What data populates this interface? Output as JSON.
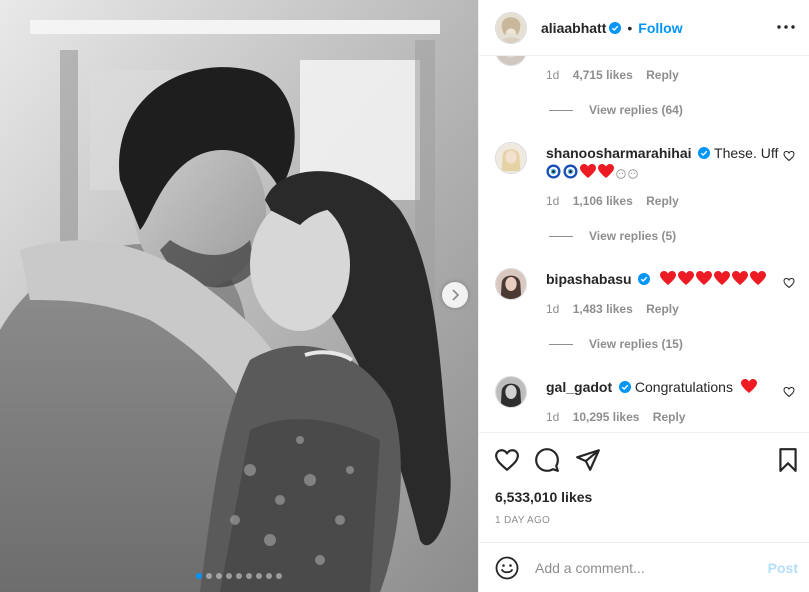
{
  "author": {
    "username": "aliaabhatt",
    "separator": "•",
    "follow_label": "Follow"
  },
  "comments": {
    "first_partial": {
      "time": "1d",
      "likes": "4,715 likes",
      "reply": "Reply",
      "view_replies": "View replies (64)"
    },
    "items": [
      {
        "username": "shanoosharmarahihai",
        "text": "These. Uff",
        "time": "1d",
        "likes": "1,106 likes",
        "reply": "Reply",
        "view_replies": "View replies (5)"
      },
      {
        "username": "bipashabasu",
        "text": "",
        "time": "1d",
        "likes": "1,483 likes",
        "reply": "Reply",
        "view_replies": "View replies (15)"
      },
      {
        "username": "gal_gadot",
        "text": "Congratulations",
        "time": "1d",
        "likes": "10,295 likes",
        "reply": "Reply"
      }
    ]
  },
  "post": {
    "likes": "6,533,010 likes",
    "time": "1 DAY AGO",
    "carousel_total_dots": 9,
    "carousel_active_dot": 1
  },
  "add_comment": {
    "placeholder": "Add a comment...",
    "post_label": "Post"
  },
  "colors": {
    "accent": "#0095f6",
    "muted": "#8e8e8e",
    "heart_red": "#ed1c24",
    "post_disabled": "#b2dffc"
  },
  "icons": [
    "verified-badge-icon",
    "more-options-icon",
    "heart-icon",
    "comment-icon",
    "share-icon",
    "bookmark-icon",
    "emoji-icon",
    "chevron-right-icon",
    "red-heart-emoji",
    "nazar-eye-emoji"
  ]
}
